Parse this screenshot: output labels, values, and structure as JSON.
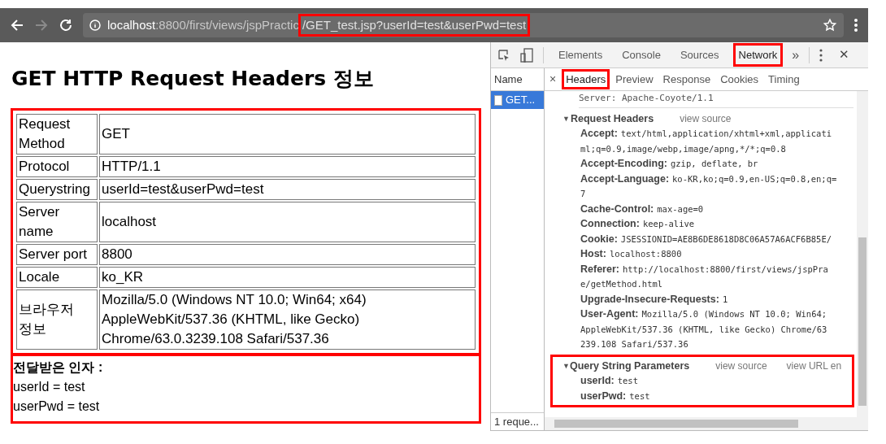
{
  "browser": {
    "url_host": "localhost",
    "url_rest": ":8800/first/views/jspPractic",
    "url_tail": "/GET_test.jsp?userId=test&userPwd=test",
    "url_tail_highlighted": true
  },
  "page": {
    "heading": "GET HTTP Request Headers 정보",
    "table_highlighted": true,
    "rows": [
      {
        "label": "Request Method",
        "value": "GET"
      },
      {
        "label": "Protocol",
        "value": "HTTP/1.1"
      },
      {
        "label": "Querystring",
        "value": "userId=test&userPwd=test"
      },
      {
        "label": "Server name",
        "value": "localhost"
      },
      {
        "label": "Server port",
        "value": "8800"
      },
      {
        "label": "Locale",
        "value": "ko_KR"
      },
      {
        "label": "브라우저 정보",
        "value": "Mozilla/5.0 (Windows NT 10.0; Win64; x64) AppleWebKit/537.36 (KHTML, like Gecko) Chrome/63.0.3239.108 Safari/537.36"
      }
    ],
    "params_highlighted": true,
    "params_title": "전달받은 인자 :",
    "params": [
      "userId = test",
      "userPwd = test"
    ]
  },
  "devtools": {
    "tabs": [
      {
        "label": "Elements",
        "selected": false,
        "highlighted": false
      },
      {
        "label": "Console",
        "selected": false,
        "highlighted": false
      },
      {
        "label": "Sources",
        "selected": false,
        "highlighted": false
      },
      {
        "label": "Network",
        "selected": true,
        "highlighted": true
      }
    ],
    "more": "»",
    "close": "✕",
    "name_header": "Name",
    "requests": [
      {
        "name": "GET...",
        "selected": true
      }
    ],
    "status": "1 reque...",
    "detail_close": "×",
    "detail_tabs": [
      {
        "label": "Headers",
        "selected": true,
        "highlighted": true
      },
      {
        "label": "Preview",
        "selected": false,
        "highlighted": false
      },
      {
        "label": "Response",
        "selected": false,
        "highlighted": false
      },
      {
        "label": "Cookies",
        "selected": false,
        "highlighted": false
      },
      {
        "label": "Timing",
        "selected": false,
        "highlighted": false
      }
    ],
    "partial_line": "Server: Apache-Coyote/1.1",
    "sections": [
      {
        "arrow": "▼",
        "title": "Request Headers",
        "links": [
          "view source"
        ],
        "expanded": true,
        "highlighted": false,
        "items": [
          {
            "name": "Accept:",
            "lines": [
              "text/html,application/xhtml+xml,applicati",
              "ml;q=0.9,image/webp,image/apng,*/*;q=0.8"
            ]
          },
          {
            "name": "Accept-Encoding:",
            "lines": [
              "gzip, deflate, br"
            ]
          },
          {
            "name": "Accept-Language:",
            "lines": [
              "ko-KR,ko;q=0.9,en-US;q=0.8,en;q=",
              "7"
            ]
          },
          {
            "name": "Cache-Control:",
            "lines": [
              "max-age=0"
            ]
          },
          {
            "name": "Connection:",
            "lines": [
              "keep-alive"
            ]
          },
          {
            "name": "Cookie:",
            "lines": [
              "JSESSIONID=AE8B6DE8618D8C06A57A6ACF6B85E/"
            ]
          },
          {
            "name": "Host:",
            "lines": [
              "localhost:8800"
            ]
          },
          {
            "name": "Referer:",
            "lines": [
              "http://localhost:8800/first/views/jspPra",
              "e/getMethod.html"
            ]
          },
          {
            "name": "Upgrade-Insecure-Requests:",
            "lines": [
              "1"
            ]
          },
          {
            "name": "User-Agent:",
            "lines": [
              "Mozilla/5.0 (Windows NT 10.0; Win64;",
              "AppleWebKit/537.36 (KHTML, like Gecko) Chrome/63",
              "239.108 Safari/537.36"
            ]
          }
        ]
      },
      {
        "arrow": "▼",
        "title": "Query String Parameters",
        "links": [
          "view source",
          "view URL en"
        ],
        "expanded": true,
        "highlighted": true,
        "items": [
          {
            "name": "userId:",
            "lines": [
              "test"
            ]
          },
          {
            "name": "userPwd:",
            "lines": [
              "test"
            ]
          }
        ]
      }
    ]
  }
}
